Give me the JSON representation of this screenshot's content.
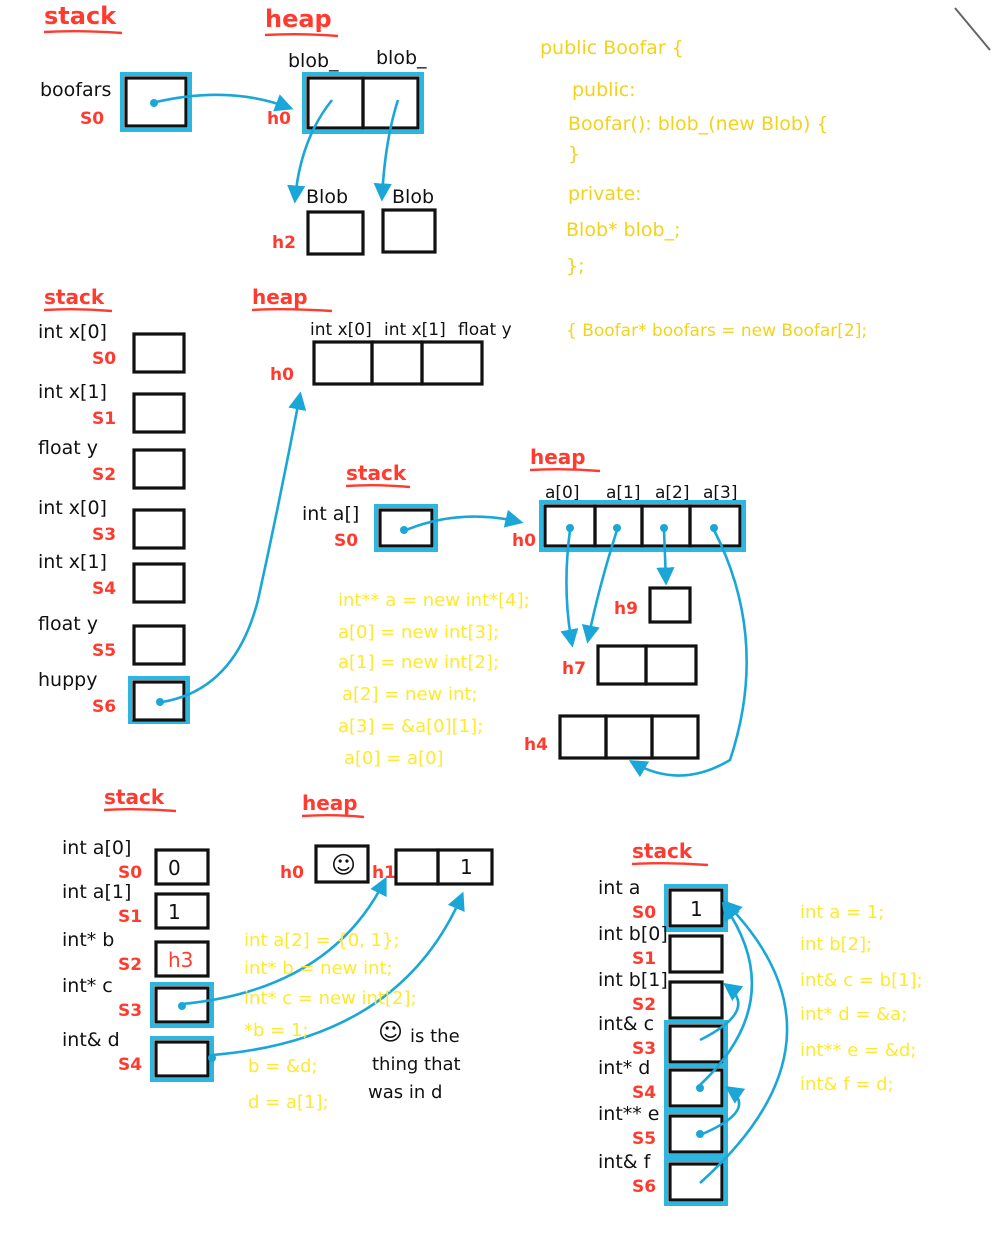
{
  "section1": {
    "stack_header": "stack",
    "heap_header": "heap",
    "var_label": "boofars",
    "var_addr": "S0",
    "heap_addr": "h0",
    "heap_h2": "h2",
    "blob_label_1": "blob_",
    "blob_label_2": "blob_",
    "blob_box_label_1": "Blob",
    "blob_box_label_2": "Blob"
  },
  "code1": {
    "lines": [
      "public Boofar {",
      "public:",
      "Boofar(): blob_(new Blob) {",
      "}",
      "private:",
      "Blob* blob_;",
      "};",
      "{ Boofar* boofars = new Boofar[2];"
    ]
  },
  "section2": {
    "stack_header": "stack",
    "heap_header": "heap",
    "stack_vars": [
      {
        "label": "int x[0]",
        "addr": "S0"
      },
      {
        "label": "int x[1]",
        "addr": "S1"
      },
      {
        "label": "float y",
        "addr": "S2"
      },
      {
        "label": "int x[0]",
        "addr": "S3"
      },
      {
        "label": "int x[1]",
        "addr": "S4"
      },
      {
        "label": "float y",
        "addr": "S5"
      },
      {
        "label": "huppy",
        "addr": "S6"
      }
    ],
    "heap_addr": "h0",
    "heap_labels": [
      "int x[0]",
      "int x[1]",
      "float y"
    ]
  },
  "section3": {
    "stack_header": "stack",
    "heap_header": "heap",
    "var_label": "int a[]",
    "var_addr": "S0",
    "heap_addr": "h0",
    "heap_labels": [
      "a[0]",
      "a[1]",
      "a[2]",
      "a[3]"
    ],
    "h9": "h9",
    "h7": "h7",
    "h4": "h4",
    "code_lines": [
      "int** a = new int*[4];",
      "a[0] = new int[3];",
      "a[1] = new int[2];",
      "a[2] = new int;",
      "a[3] = &a[0][1];",
      "a[0] = a[0]"
    ]
  },
  "section4": {
    "stack_header": "stack",
    "heap_header": "heap",
    "stack_vars": [
      {
        "label": "int a[0]",
        "addr": "S0",
        "value": "0"
      },
      {
        "label": "int a[1]",
        "addr": "S1",
        "value": "1"
      },
      {
        "label": "int* b",
        "addr": "S2",
        "value": "h3"
      },
      {
        "label": "int* c",
        "addr": "S3",
        "value": ""
      },
      {
        "label": "int& d",
        "addr": "S4",
        "value": ""
      }
    ],
    "heap_h0": "h0",
    "heap_h1": "h1",
    "heap_h1_value": "1",
    "smiley": "☺",
    "note_lines": [
      "is the",
      "thing that",
      "was in  d"
    ],
    "code_lines": [
      "int a[2] = {0, 1};",
      "int* b = new int;",
      "int* c = new int[2];",
      "*b = 1;",
      "b = &d;",
      "d = a[1];"
    ]
  },
  "section5": {
    "stack_header": "stack",
    "stack_vars": [
      {
        "label": "int a",
        "addr": "S0",
        "value": "1"
      },
      {
        "label": "int b[0]",
        "addr": "S1",
        "value": ""
      },
      {
        "label": "int b[1]",
        "addr": "S2",
        "value": ""
      },
      {
        "label": "int& c",
        "addr": "S3",
        "value": ""
      },
      {
        "label": "int* d",
        "addr": "S4",
        "value": ""
      },
      {
        "label": "int** e",
        "addr": "S5",
        "value": ""
      },
      {
        "label": "int& f",
        "addr": "S6",
        "value": ""
      }
    ],
    "code_lines": [
      "int a = 1;",
      "int b[2];",
      "int& c = b[1];",
      "int* d = &a;",
      "int** e = &d;",
      "int& f = d;"
    ]
  },
  "colors": {
    "header_red": "#ff3b2f",
    "pointer_blue": "#1aa7d8",
    "code_yellow": "#f2d31b",
    "ink": "#111111"
  }
}
